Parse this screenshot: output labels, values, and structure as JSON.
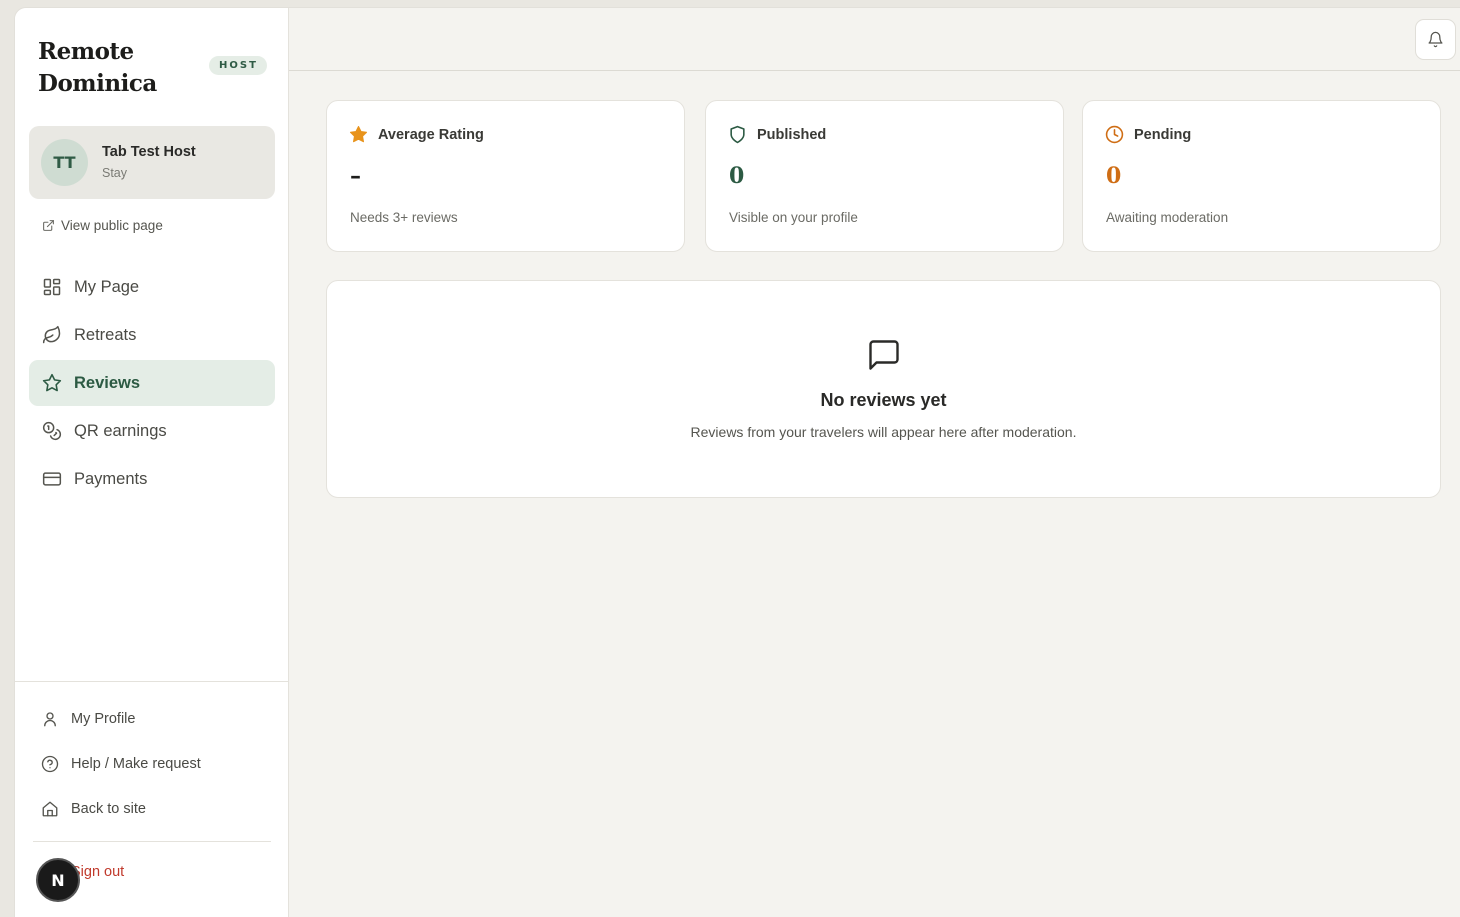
{
  "brand": {
    "line1": "Remote",
    "line2": "Dominica",
    "badge": "HOST"
  },
  "user": {
    "initials": "TT",
    "name": "Tab Test Host",
    "role": "Stay"
  },
  "public_link": "View public page",
  "nav": {
    "items": [
      {
        "label": "My Page",
        "icon": "grid-icon"
      },
      {
        "label": "Retreats",
        "icon": "leaf-icon"
      },
      {
        "label": "Reviews",
        "icon": "star-icon",
        "active": true
      },
      {
        "label": "QR earnings",
        "icon": "coins-icon"
      },
      {
        "label": "Payments",
        "icon": "credit-card-icon"
      }
    ]
  },
  "bottom_nav": {
    "items": [
      {
        "label": "My Profile",
        "icon": "user-icon"
      },
      {
        "label": "Help / Make request",
        "icon": "help-circle-icon"
      },
      {
        "label": "Back to site",
        "icon": "home-icon"
      }
    ],
    "signout": "Sign out",
    "dev_badge": "N"
  },
  "stats": [
    {
      "title": "Average Rating",
      "value": "–",
      "sub": "Needs 3+ reviews",
      "icon": "star-filled-icon",
      "color": "#e8931b"
    },
    {
      "title": "Published",
      "value": "0",
      "sub": "Visible on your profile",
      "icon": "shield-icon",
      "color": "#2c5a43"
    },
    {
      "title": "Pending",
      "value": "0",
      "sub": "Awaiting moderation",
      "icon": "clock-icon",
      "color": "#cf6d14"
    }
  ],
  "empty_state": {
    "title": "No reviews yet",
    "subtitle": "Reviews from your travelers will appear here after moderation.",
    "icon": "message-square-icon"
  },
  "colors": {
    "accent": "#2c5a43",
    "active_bg": "#e4ede6",
    "danger": "#c0392b"
  }
}
